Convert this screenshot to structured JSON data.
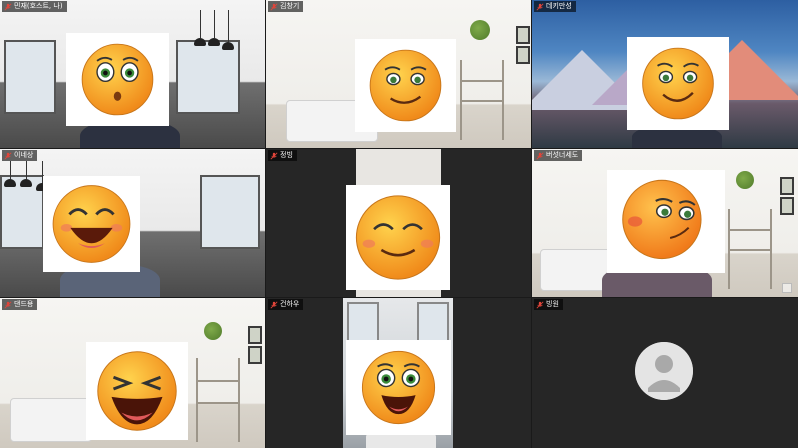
{
  "participants": [
    {
      "name": "민재(호스트, 나)",
      "face": "surprised",
      "bg": "office",
      "active": false
    },
    {
      "name": "김창기",
      "face": "smirk",
      "bg": "living",
      "active": false
    },
    {
      "name": "데키만성",
      "face": "smirk2",
      "bg": "mountain",
      "active": false
    },
    {
      "name": "이네상",
      "face": "laugh-blush",
      "bg": "office",
      "active": false
    },
    {
      "name": "정빙",
      "face": "content",
      "bg": "dark",
      "active": false
    },
    {
      "name": "버섯너세도",
      "face": "wink-blush",
      "bg": "living",
      "active": true
    },
    {
      "name": "댄드용",
      "face": "xd-laugh",
      "bg": "living",
      "active": false
    },
    {
      "name": "건하우",
      "face": "grin",
      "bg": "dark",
      "active": false
    },
    {
      "name": "빙원",
      "face": "avatar",
      "bg": "dark",
      "active": false
    }
  ],
  "colors": {
    "active_border": "#2ee08a",
    "mute_red": "#e0453a",
    "emoji_yellow": "#f7b731",
    "emoji_orange": "#f08a1a",
    "background": "#1a1a1a"
  },
  "icons": {
    "mute": "mic-muted-icon",
    "avatar": "person-silhouette-icon"
  }
}
